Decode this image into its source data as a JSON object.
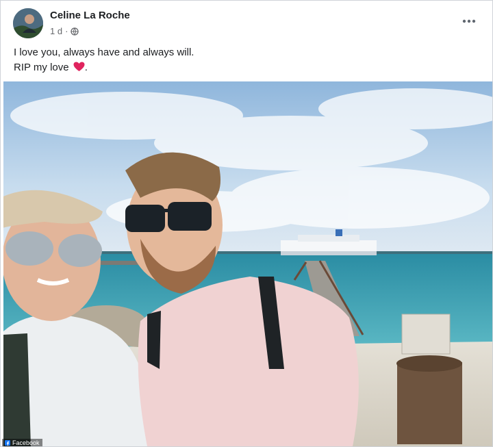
{
  "post": {
    "author": "Celine La Roche",
    "timestamp": "1 d",
    "privacy_icon": "globe-icon",
    "more_icon": "more-options-icon",
    "caption_line1": "I love you, always have and always will.",
    "caption_line2": "RIP my love",
    "caption_emoji": "heart-icon",
    "caption_suffix": ".",
    "watermark": "Facebook"
  },
  "colors": {
    "heart": "#e0245e",
    "text_primary": "#1c1e21",
    "text_secondary": "#65676b"
  }
}
